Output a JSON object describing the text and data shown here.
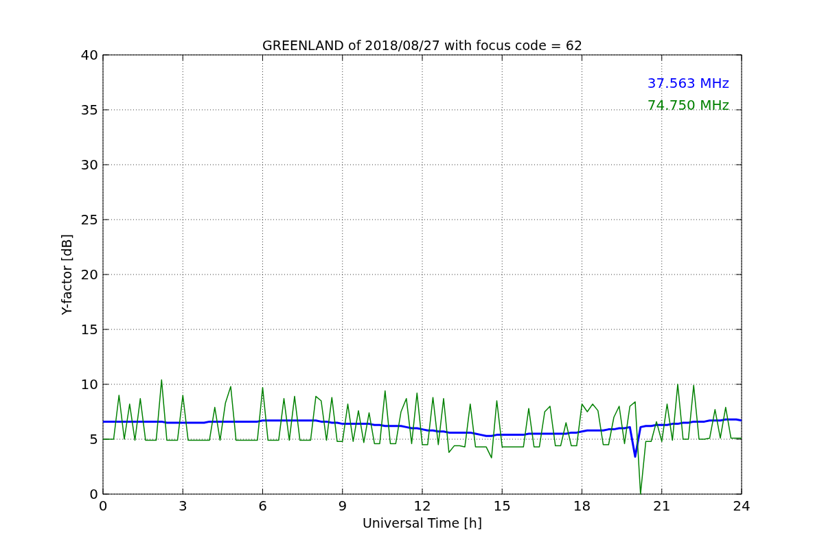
{
  "chart_data": {
    "type": "line",
    "title": "GREENLAND of 2018/08/27 with focus code = 62",
    "xlabel": "Universal Time [h]",
    "ylabel": "Y-factor [dB]",
    "x": [
      0,
      0.2,
      0.4,
      0.6,
      0.8,
      1,
      1.2,
      1.4,
      1.6,
      1.8,
      2,
      2.2,
      2.4,
      2.6,
      2.8,
      3,
      3.2,
      3.4,
      3.6,
      3.8,
      4,
      4.2,
      4.4,
      4.6,
      4.8,
      5,
      5.2,
      5.4,
      5.6,
      5.8,
      6,
      6.2,
      6.4,
      6.6,
      6.8,
      7,
      7.2,
      7.4,
      7.6,
      7.8,
      8,
      8.2,
      8.4,
      8.6,
      8.8,
      9,
      9.2,
      9.4,
      9.6,
      9.8,
      10,
      10.2,
      10.4,
      10.6,
      10.8,
      11,
      11.2,
      11.4,
      11.6,
      11.8,
      12,
      12.2,
      12.4,
      12.6,
      12.8,
      13,
      13.2,
      13.4,
      13.6,
      13.8,
      14,
      14.2,
      14.4,
      14.6,
      14.8,
      15,
      15.2,
      15.4,
      15.6,
      15.8,
      16,
      16.2,
      16.4,
      16.6,
      16.8,
      17,
      17.2,
      17.4,
      17.6,
      17.8,
      18,
      18.2,
      18.4,
      18.6,
      18.8,
      19,
      19.2,
      19.4,
      19.6,
      19.8,
      20,
      20.2,
      20.4,
      20.6,
      20.8,
      21,
      21.2,
      21.4,
      21.6,
      21.8,
      22,
      22.2,
      22.4,
      22.6,
      22.8,
      23,
      23.2,
      23.4,
      23.6,
      23.8,
      24
    ],
    "series": [
      {
        "name": "37.563 MHz",
        "color": "#0000ff",
        "values": [
          6.6,
          6.6,
          6.6,
          6.6,
          6.6,
          6.6,
          6.6,
          6.6,
          6.6,
          6.6,
          6.6,
          6.6,
          6.5,
          6.5,
          6.5,
          6.5,
          6.5,
          6.5,
          6.5,
          6.5,
          6.6,
          6.6,
          6.6,
          6.6,
          6.6,
          6.6,
          6.6,
          6.6,
          6.6,
          6.6,
          6.7,
          6.7,
          6.7,
          6.7,
          6.7,
          6.7,
          6.7,
          6.7,
          6.7,
          6.7,
          6.7,
          6.6,
          6.6,
          6.5,
          6.5,
          6.4,
          6.4,
          6.4,
          6.4,
          6.4,
          6.4,
          6.3,
          6.3,
          6.2,
          6.2,
          6.2,
          6.2,
          6.1,
          6.0,
          6.0,
          5.9,
          5.8,
          5.8,
          5.7,
          5.7,
          5.6,
          5.6,
          5.6,
          5.6,
          5.6,
          5.5,
          5.4,
          5.3,
          5.3,
          5.4,
          5.4,
          5.4,
          5.4,
          5.4,
          5.4,
          5.5,
          5.5,
          5.5,
          5.5,
          5.5,
          5.5,
          5.5,
          5.5,
          5.6,
          5.6,
          5.7,
          5.8,
          5.8,
          5.8,
          5.8,
          5.9,
          5.9,
          6.0,
          6.0,
          6.1,
          3.4,
          6.1,
          6.2,
          6.2,
          6.3,
          6.3,
          6.3,
          6.4,
          6.4,
          6.5,
          6.5,
          6.6,
          6.6,
          6.6,
          6.7,
          6.7,
          6.7,
          6.8,
          6.8,
          6.8,
          6.7
        ]
      },
      {
        "name": "74.750 MHz",
        "color": "#008000",
        "values": [
          5.0,
          5.0,
          5.0,
          9.0,
          5.0,
          8.2,
          4.9,
          8.7,
          4.9,
          4.9,
          4.9,
          10.4,
          4.9,
          4.9,
          4.9,
          9.0,
          4.9,
          4.9,
          4.9,
          4.9,
          4.9,
          7.9,
          4.9,
          8.3,
          9.8,
          4.9,
          4.9,
          4.9,
          4.9,
          4.9,
          9.7,
          4.9,
          4.9,
          4.9,
          8.7,
          4.9,
          8.9,
          4.9,
          4.9,
          4.9,
          8.9,
          8.5,
          4.9,
          8.8,
          4.8,
          4.8,
          8.2,
          4.8,
          7.6,
          4.7,
          7.4,
          4.6,
          4.6,
          9.4,
          4.6,
          4.6,
          7.5,
          8.7,
          4.6,
          9.2,
          4.5,
          4.5,
          8.8,
          4.5,
          8.7,
          3.8,
          4.4,
          4.4,
          4.3,
          8.2,
          4.3,
          4.3,
          4.3,
          3.3,
          8.5,
          4.3,
          4.3,
          4.3,
          4.3,
          4.3,
          7.8,
          4.3,
          4.3,
          7.5,
          8.0,
          4.4,
          4.4,
          6.5,
          4.4,
          4.4,
          8.2,
          7.5,
          8.2,
          7.6,
          4.5,
          4.5,
          7.0,
          8.0,
          4.6,
          8.0,
          8.4,
          0.0,
          4.8,
          4.8,
          6.6,
          4.8,
          8.2,
          4.9,
          10.0,
          5.0,
          5.0,
          9.9,
          5.0,
          5.0,
          5.1,
          7.7,
          5.1,
          7.9,
          5.1,
          5.1,
          5.1
        ]
      }
    ],
    "grid": true,
    "xlim": [
      0,
      24
    ],
    "ylim": [
      0,
      40
    ],
    "xticks": [
      0,
      3,
      6,
      9,
      12,
      15,
      18,
      21,
      24
    ],
    "yticks": [
      0,
      5,
      10,
      15,
      20,
      25,
      30,
      35,
      40
    ]
  }
}
